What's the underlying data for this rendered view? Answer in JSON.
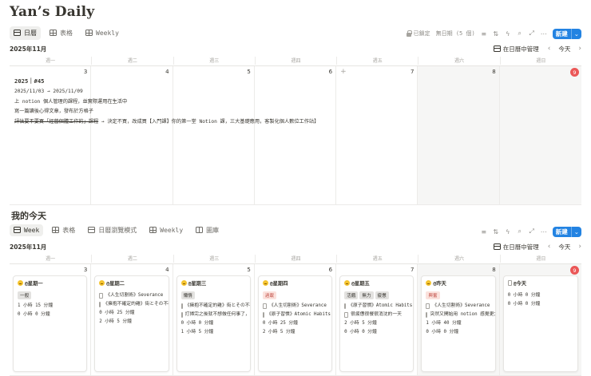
{
  "page_title": "Yan’s Daily",
  "view1": {
    "tabs": [
      {
        "label": "日曆",
        "icon": "calendar-icon",
        "active": true
      },
      {
        "label": "表格",
        "icon": "table-icon",
        "active": false
      },
      {
        "label": "Weekly",
        "icon": "table-icon",
        "active": false
      }
    ],
    "locked_label": "已鎖定",
    "no_date_label": "無日期 (5 個)",
    "new_label": "新建",
    "month_label": "2025年11月",
    "manage_label": "在日曆中管理",
    "today_label": "今天",
    "weekdays": [
      "週一",
      "週二",
      "週三",
      "週四",
      "週五",
      "週六",
      "週日"
    ],
    "days": [
      "3",
      "4",
      "5",
      "6",
      "7",
      "8",
      "9"
    ],
    "event": {
      "title": "2025｜#45",
      "date_range": "2025/11/03 → 2025/11/09",
      "lines": [
        "上 notion 個人管理的課程，並實際運用在生活中",
        "寫一篇讀後心得文章，發布於方格子"
      ],
      "struck": "評估要不要買「經營個體工作的」課程",
      "struck_tail": "→ 決定不買，改成買【入門課】你的第一堂 Notion 課，三大基礎應用，客製化個人數位工作站】"
    }
  },
  "section_heading": "我的今天",
  "view2": {
    "tabs": [
      {
        "label": "Week",
        "icon": "calendar-icon",
        "active": true
      },
      {
        "label": "表格",
        "icon": "table-icon",
        "active": false
      },
      {
        "label": "日曆瀏覽模式",
        "icon": "calendar-icon",
        "active": false
      },
      {
        "label": "Weekly",
        "icon": "table-icon",
        "active": false
      },
      {
        "label": "圖庫",
        "icon": "gallery-icon",
        "active": false
      }
    ],
    "new_label": "新建",
    "month_label": "2025年11月",
    "manage_label": "在日曆中管理",
    "today_label": "今天",
    "weekdays": [
      "週一",
      "週二",
      "週三",
      "週四",
      "週五",
      "週六",
      "週日"
    ],
    "days": [
      "3",
      "4",
      "5",
      "6",
      "7",
      "8",
      "9"
    ],
    "cards": [
      {
        "title": "@星期一",
        "tags": [
          {
            "label": "一般",
            "bg": "#e3e2e0",
            "color": "#37352f"
          }
        ],
        "lines": [
          "1 小時 15 分鐘",
          "0 小時 0 分鐘"
        ],
        "docs": []
      },
      {
        "title": "@星期二",
        "tags": [],
        "lines": [
          "0 小時 25 分鐘",
          "2 小時 5 分鐘"
        ],
        "docs": [
          "《人生切割術》Severance",
          "《擁抱不確定的雞》街とその不確"
        ]
      },
      {
        "title": "@星期三",
        "tags": [
          {
            "label": "懶惰",
            "bg": "#e3e2e0",
            "color": "#37352f"
          }
        ],
        "lines": [
          "0 小時 0 分鐘",
          "1 小時 5 分鐘"
        ],
        "docs": [
          "《擁抱不確定的雞》街とその不確",
          "打掃完之後就不想做任何事了，好"
        ]
      },
      {
        "title": "@星期四",
        "tags": [
          {
            "label": "過載",
            "bg": "#fbe2dd",
            "color": "#c4554d"
          }
        ],
        "lines": [
          "0 小時 25 分鐘",
          "2 小時 5 分鐘"
        ],
        "docs": [
          "《人生切割術》Severance",
          "《原子習慣》Atomic Habits"
        ]
      },
      {
        "title": "@星期五",
        "tags": [
          {
            "label": "活餓",
            "bg": "#e3e2e0",
            "color": "#37352f"
          },
          {
            "label": "無力",
            "bg": "#e3e2e0",
            "color": "#37352f"
          },
          {
            "label": "疲憊",
            "bg": "#e3e2e0",
            "color": "#37352f"
          }
        ],
        "lines": [
          "2 小時 5 分鐘",
          "0 小時 0 分鐘"
        ],
        "docs": [
          "《原子習慣》Atomic Habits",
          "很疲憊很餐很消沈的一天"
        ]
      },
      {
        "title": "@昨天",
        "tags": [
          {
            "label": "興奮",
            "bg": "#fbe2dd",
            "color": "#c4554d"
          }
        ],
        "lines": [
          "1 小時 40 分鐘",
          "0 小時 0 分鐘"
        ],
        "docs": [
          "《人生切割術》Severance",
          "突然又開始用 notion 感覺更大"
        ]
      },
      {
        "title": "@今天",
        "tags": [],
        "lines": [
          "0 小時 0 分鐘",
          "0 小時 0 分鐘"
        ],
        "docs": []
      }
    ]
  },
  "colors": {
    "accent": "#2383e2",
    "today_badge": "#eb5757"
  }
}
